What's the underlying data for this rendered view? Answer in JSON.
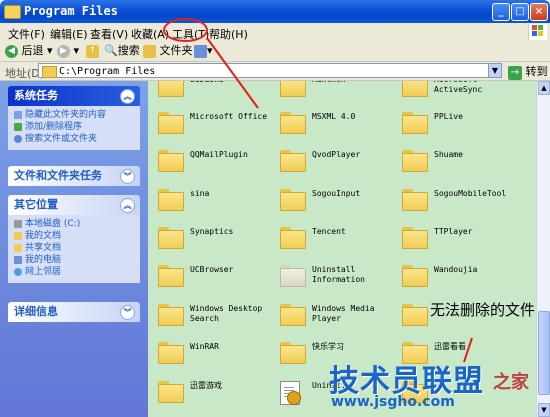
{
  "window": {
    "title": "Program Files",
    "controls": [
      "_",
      "□",
      "×"
    ]
  },
  "menu": {
    "items": [
      "文件(F)",
      "编辑(E)",
      "查看(V)",
      "收藏(A)",
      "工具(T)",
      "帮助(H)"
    ]
  },
  "toolbar": {
    "back": "后退",
    "search": "搜索",
    "folders": "文件夹"
  },
  "address": {
    "label": "地址(D)",
    "path": "C:\\Program Files",
    "go": "转到"
  },
  "taskpane": {
    "system_tasks": {
      "title": "系统任务",
      "items": [
        "隐藏此文件夹的内容",
        "添加/删除程序",
        "搜索文件或文件夹"
      ]
    },
    "file_tasks": {
      "title": "文件和文件夹任务"
    },
    "other_places": {
      "title": "其它位置",
      "items": [
        "本地磁盘 (C:)",
        "我的文档",
        "共享文档",
        "我的电脑",
        "网上邻居"
      ]
    },
    "details": {
      "title": "详细信息"
    }
  },
  "files": [
    "LuDaShi",
    "Maxthon",
    "Microsoft ActiveSync",
    "Microsoft Office",
    "MSXML 4.0",
    "PPLive",
    "QQMailPlugin",
    "QvodPlayer",
    "Shuame",
    "sina",
    "SogouInput",
    "SogouMobileTool",
    "Synaptics",
    "Tencent",
    "TTPlayer",
    "UCBrowser",
    "Uninstall Information",
    "Wandoujia",
    "Windows Desktop Search",
    "Windows Media Player",
    "",
    "WinRAR",
    "快乐学习",
    "迅雷看看",
    "迅雷游戏",
    "Uninst...",
    ""
  ],
  "annotation": {
    "text": "无法删除的文件"
  },
  "watermark": {
    "brand": "技术员联盟",
    "tail": "之家",
    "url": "www.jsgho.com"
  }
}
